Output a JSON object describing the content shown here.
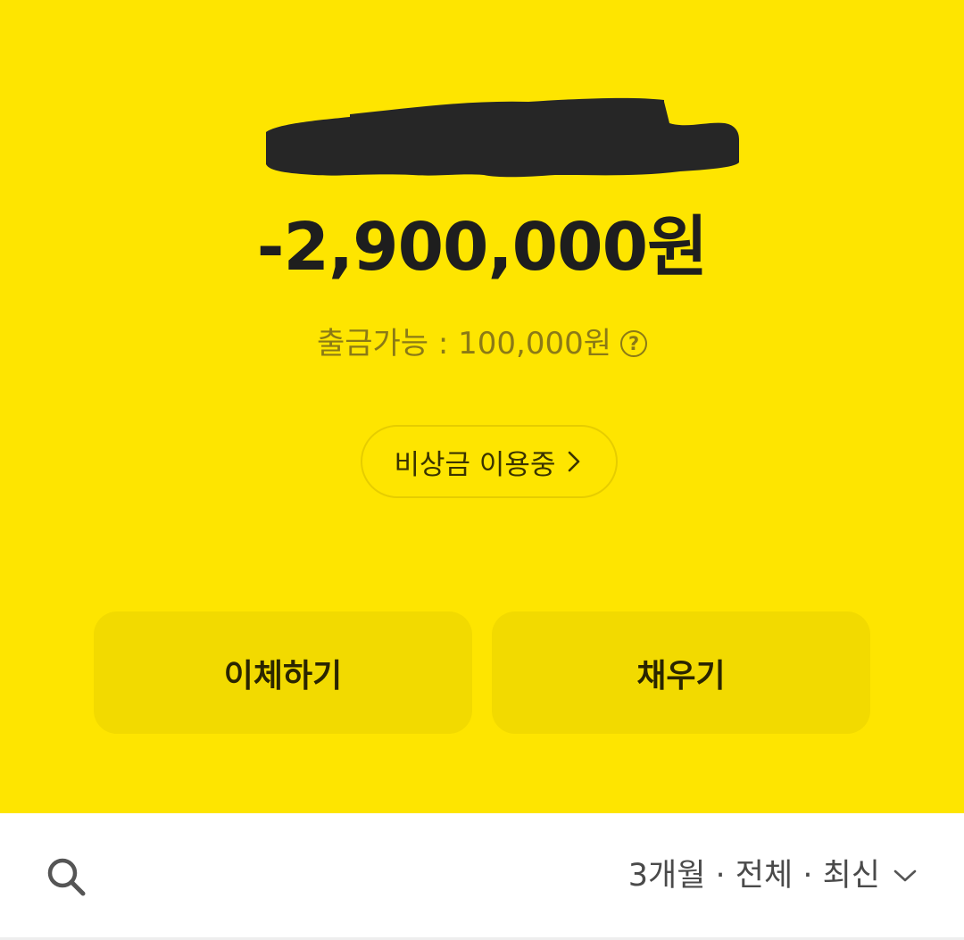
{
  "account": {
    "balance": "-2,900,000원",
    "withdrawable": "출금가능 : 100,000원",
    "help_symbol": "?",
    "emergency_label": "비상금 이용중"
  },
  "actions": {
    "transfer_label": "이체하기",
    "fill_label": "채우기"
  },
  "filter": {
    "text": "3개월 · 전체 · 최신"
  },
  "icons": {
    "redaction": "redacted-name-scribble",
    "help": "question-circle-icon",
    "emergency_chevron": "chevron-right-icon",
    "search": "search-icon",
    "filter_chevron": "chevron-down-icon"
  },
  "colors": {
    "brand_yellow": "#FEE500",
    "button_yellow": "#F2DA00",
    "text_dark": "#1e1e1e",
    "muted_olive": "#8b7a16"
  }
}
